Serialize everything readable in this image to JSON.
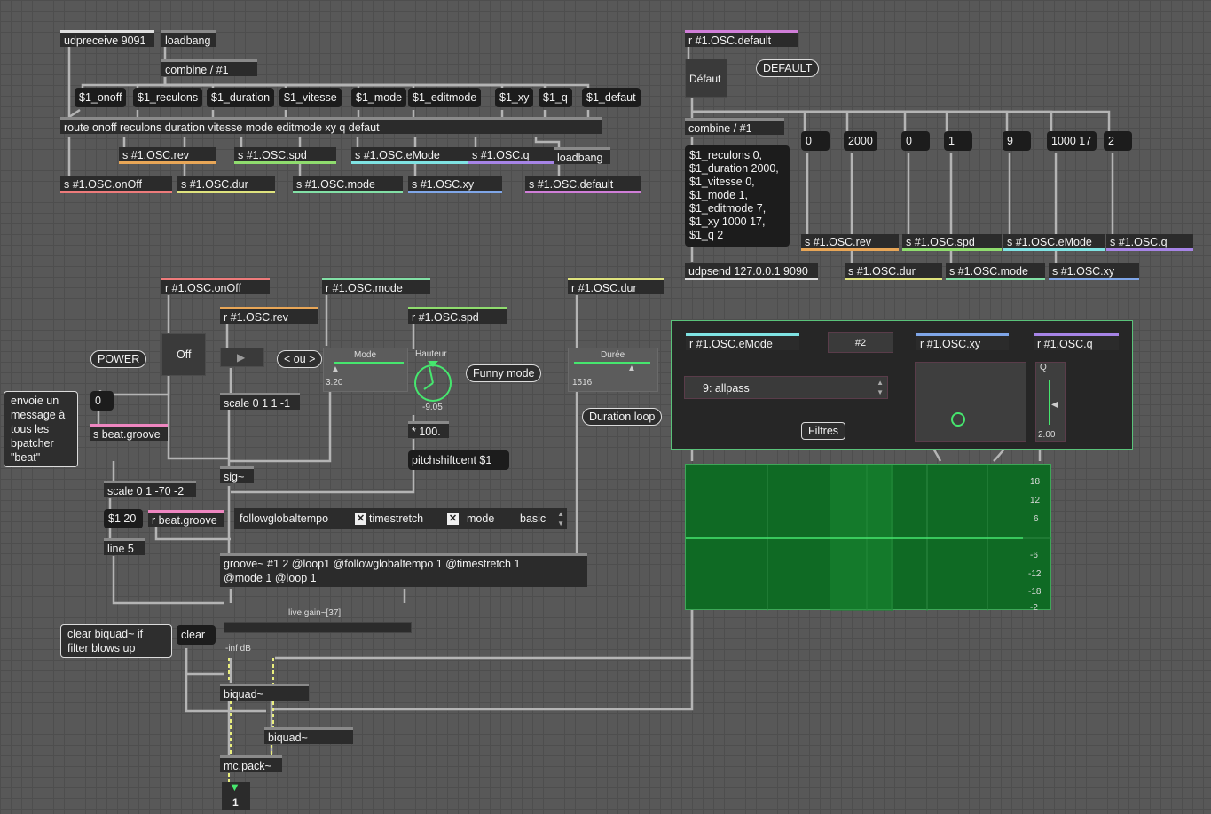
{
  "objects": {
    "udpreceive": "udpreceive 9091",
    "loadbang_top": "loadbang",
    "combine_top": "combine / #1",
    "route": "route onoff reculons duration vitesse mode editmode xy q defaut",
    "s_rev": "s #1.OSC.rev",
    "s_spd": "s #1.OSC.spd",
    "s_emode": "s #1.OSC.eMode",
    "s_q": "s #1.OSC.q",
    "loadbang_mid": "loadbang",
    "s_onoff": "s #1.OSC.onOff",
    "s_dur": "s #1.OSC.dur",
    "s_mode": "s #1.OSC.mode",
    "s_xy": "s #1.OSC.xy",
    "s_default": "s #1.OSC.default",
    "r_default": "r #1.OSC.default",
    "combine_right": "combine / #1",
    "s_rev2": "s #1.OSC.rev",
    "s_spd2": "s #1.OSC.spd",
    "s_emode2": "s #1.OSC.eMode",
    "s_q2": "s #1.OSC.q",
    "udpsend": "udpsend 127.0.0.1 9090",
    "s_dur2": "s #1.OSC.dur",
    "s_mode2": "s #1.OSC.mode",
    "s_xy2": "s #1.OSC.xy",
    "r_onoff": "r #1.OSC.onOff",
    "r_mode": "r #1.OSC.mode",
    "r_dur": "r #1.OSC.dur",
    "r_rev": "r #1.OSC.rev",
    "r_spd": "r #1.OSC.spd",
    "scale_rev": "scale 0 1 1 -1",
    "mul100": "* 100.",
    "pitchshift": "pitchshiftcent $1",
    "s_beat": "s beat.groove",
    "sig": "sig~",
    "scale_gain": "scale 0 1 -70 -2",
    "r_beat": "r beat.groove",
    "line5": "line 5",
    "groove_l1": "groove~ #1 2 @loop1 @followglobaltempo 1 @timestretch 1",
    "groove_l2": "@mode 1 @loop 1",
    "biquad1": "biquad~",
    "biquad2": "biquad~",
    "mcpack": "mc.pack~",
    "r_emode": "r #1.OSC.eMode",
    "r_xy": "r #1.OSC.xy",
    "r_q": "r #1.OSC.q"
  },
  "messages": {
    "onoff": "$1_onoff",
    "reculons": "$1_reculons",
    "duration": "$1_duration",
    "vitesse": "$1_vitesse",
    "mode": "$1_mode",
    "editmode": "$1_editmode",
    "xy": "$1_xy",
    "q": "$1_q",
    "defaut": "$1_defaut",
    "m0a": "0",
    "m2000": "2000",
    "m0b": "0",
    "m1": "1",
    "m9": "9",
    "m1000": "1000 17",
    "m2": "2",
    "big": [
      "$1_reculons 0,",
      "$1_duration 2000,",
      "$1_vitesse 0,",
      "$1_mode 1,",
      "$1_editmode 7,",
      "$1_xy 1000 17,",
      "$1_q 2"
    ],
    "zero": "0",
    "line_target": "$1 20",
    "clear": "clear"
  },
  "ui": {
    "defaut_button": "Défaut",
    "off_toggle": "Off",
    "mode_label": "Mode",
    "mode_value": "3.20",
    "hauteur_label": "Hauteur",
    "hauteur_value": "-9.05",
    "duree_label": "Durée",
    "duree_value": "1516",
    "followglobaltempo": "followglobaltempo",
    "timestretch": "timestretch",
    "mode_attr": "mode",
    "mode_menu": "basic",
    "filter_menu": "9: allpass",
    "bpatcher_num": "#2",
    "q_label": "Q",
    "q_value": "2.00",
    "gain_name": "live.gain~[37]",
    "gain_db": "-inf dB",
    "mc_count": "1",
    "filter_scale": [
      "18",
      "12",
      "6",
      "-6",
      "-12",
      "-18",
      "-2"
    ]
  },
  "comments": {
    "default": "DEFAULT",
    "power": "POWER",
    "ou": "< ou >",
    "funny": "Funny mode",
    "duration_loop": "Duration loop",
    "envoie": [
      "envoie un",
      "message à",
      "tous les",
      "bpatcher",
      "\"beat\""
    ],
    "filtres": "Filtres",
    "clear_note": [
      "clear biquad~ if",
      "filter blows up"
    ]
  },
  "colors": {
    "rev": "#e8a657",
    "spd": "#8fdc6e",
    "emode": "#7fe3e3",
    "q": "#a684e6",
    "onoff": "#ee7b7b",
    "dur": "#dfe37e",
    "mode": "#82e0a6",
    "xy": "#7fa6e8",
    "default": "#d07ed8",
    "beat": "#ee86c0",
    "filter_bg": "#0f6a24",
    "filter_curve": "#46e66e"
  }
}
